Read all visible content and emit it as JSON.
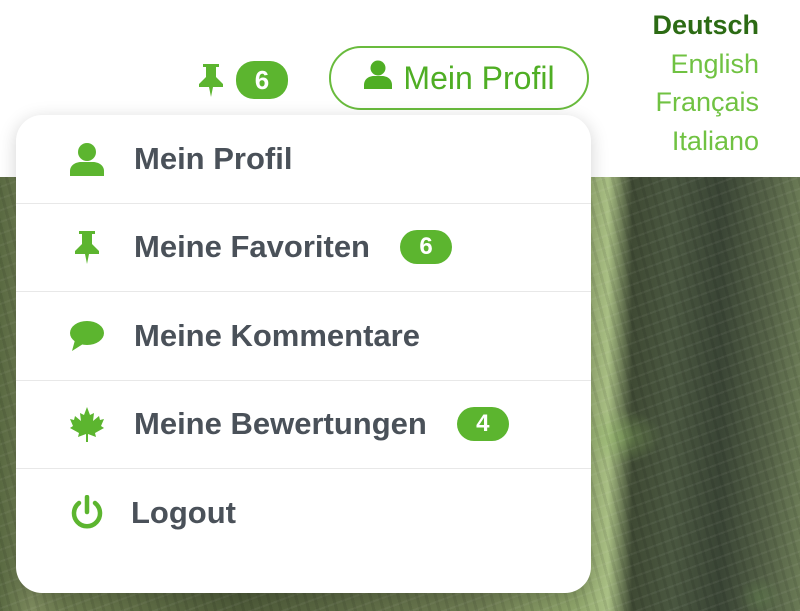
{
  "header": {
    "favorites_count": "6",
    "profile_button_label": "Mein Profil"
  },
  "languages": [
    {
      "label": "Deutsch",
      "active": true
    },
    {
      "label": "English",
      "active": false
    },
    {
      "label": "Français",
      "active": false
    },
    {
      "label": "Italiano",
      "active": false
    }
  ],
  "menu": {
    "items": [
      {
        "label": "Mein Profil",
        "icon": "user-icon",
        "badge": ""
      },
      {
        "label": "Meine Favoriten",
        "icon": "pin-icon",
        "badge": "6"
      },
      {
        "label": "Meine Kommentare",
        "icon": "comment-icon",
        "badge": ""
      },
      {
        "label": "Meine Bewertungen",
        "icon": "maple-leaf-icon",
        "badge": "4"
      },
      {
        "label": "Logout",
        "icon": "power-icon",
        "badge": ""
      }
    ]
  },
  "colors": {
    "accent": "#5cb52f",
    "active_language": "#2c6b14",
    "menu_text": "#4a5159"
  }
}
